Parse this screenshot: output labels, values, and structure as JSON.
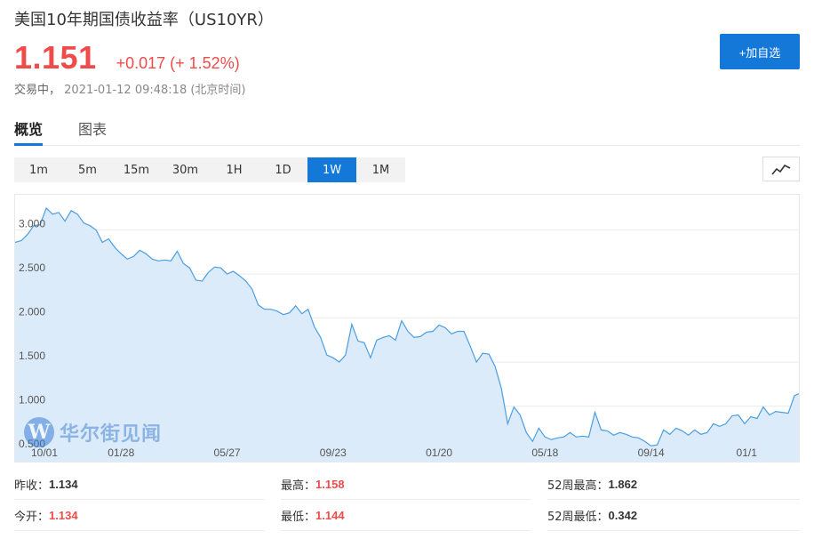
{
  "header": {
    "title": "美国10年期国债收益率（US10YR）",
    "price": "1.151",
    "change": "+0.017 (+ 1.52%)",
    "status": "交易中，",
    "timestamp": "2021-01-12 09:48:18 (北京时间)",
    "add_button": "+加自选"
  },
  "tabs": [
    {
      "label": "概览",
      "active": true
    },
    {
      "label": "图表",
      "active": false
    }
  ],
  "periods": [
    "1m",
    "5m",
    "15m",
    "30m",
    "1H",
    "1D",
    "1W",
    "1M"
  ],
  "active_period": "1W",
  "chart_type_icon": "line-chart-icon",
  "watermark": {
    "glyph": "W",
    "text": "华尔街见闻"
  },
  "colors": {
    "accent": "#1478d8",
    "up": "#f04b4b",
    "line": "#4a9ee0",
    "fill": "#dcebfa"
  },
  "chart_data": {
    "type": "area",
    "ylim": [
      0.35,
      3.4
    ],
    "yticks": [
      {
        "v": 3.0,
        "label": "3.000"
      },
      {
        "v": 2.5,
        "label": "2.500"
      },
      {
        "v": 2.0,
        "label": "2.000"
      },
      {
        "v": 1.5,
        "label": "1.500"
      },
      {
        "v": 1.0,
        "label": "1.000"
      },
      {
        "v": 0.5,
        "label": "0.500"
      }
    ],
    "xticks": [
      {
        "i": 0,
        "label": "10/01"
      },
      {
        "i": 17,
        "label": "01/28"
      },
      {
        "i": 34,
        "label": "05/27"
      },
      {
        "i": 51,
        "label": "09/23"
      },
      {
        "i": 68,
        "label": "01/20"
      },
      {
        "i": 85,
        "label": "05/18"
      },
      {
        "i": 102,
        "label": "09/14"
      },
      {
        "i": 119,
        "label": "01/1"
      }
    ],
    "values": [
      2.86,
      2.88,
      2.95,
      3.05,
      3.06,
      3.25,
      3.18,
      3.2,
      3.1,
      3.22,
      3.18,
      3.08,
      3.05,
      3.0,
      2.86,
      2.9,
      2.8,
      2.73,
      2.67,
      2.7,
      2.77,
      2.73,
      2.67,
      2.65,
      2.66,
      2.65,
      2.76,
      2.62,
      2.57,
      2.43,
      2.42,
      2.52,
      2.58,
      2.57,
      2.5,
      2.53,
      2.48,
      2.42,
      2.33,
      2.15,
      2.1,
      2.1,
      2.08,
      2.04,
      2.06,
      2.14,
      2.05,
      2.1,
      1.9,
      1.78,
      1.58,
      1.55,
      1.5,
      1.58,
      1.93,
      1.74,
      1.72,
      1.55,
      1.75,
      1.78,
      1.8,
      1.75,
      1.97,
      1.85,
      1.78,
      1.79,
      1.84,
      1.85,
      1.92,
      1.89,
      1.82,
      1.85,
      1.85,
      1.68,
      1.5,
      1.6,
      1.59,
      1.45,
      1.2,
      0.8,
      0.99,
      0.9,
      0.7,
      0.6,
      0.75,
      0.65,
      0.62,
      0.64,
      0.65,
      0.7,
      0.65,
      0.66,
      0.65,
      0.93,
      0.73,
      0.72,
      0.67,
      0.7,
      0.68,
      0.65,
      0.64,
      0.6,
      0.55,
      0.56,
      0.73,
      0.68,
      0.75,
      0.72,
      0.67,
      0.73,
      0.68,
      0.7,
      0.8,
      0.77,
      0.8,
      0.89,
      0.9,
      0.8,
      0.88,
      0.86,
      0.99,
      0.9,
      0.94,
      0.93,
      0.92,
      1.12,
      1.15
    ]
  },
  "stats": [
    {
      "label": "昨收：",
      "value": "1.134",
      "red": false
    },
    {
      "label": "最高：",
      "value": "1.158",
      "red": true
    },
    {
      "label": "52周最高：",
      "value": "1.862",
      "red": false
    },
    {
      "label": "今开：",
      "value": "1.134",
      "red": true
    },
    {
      "label": "最低：",
      "value": "1.144",
      "red": true
    },
    {
      "label": "52周最低：",
      "value": "0.342",
      "red": false
    }
  ]
}
